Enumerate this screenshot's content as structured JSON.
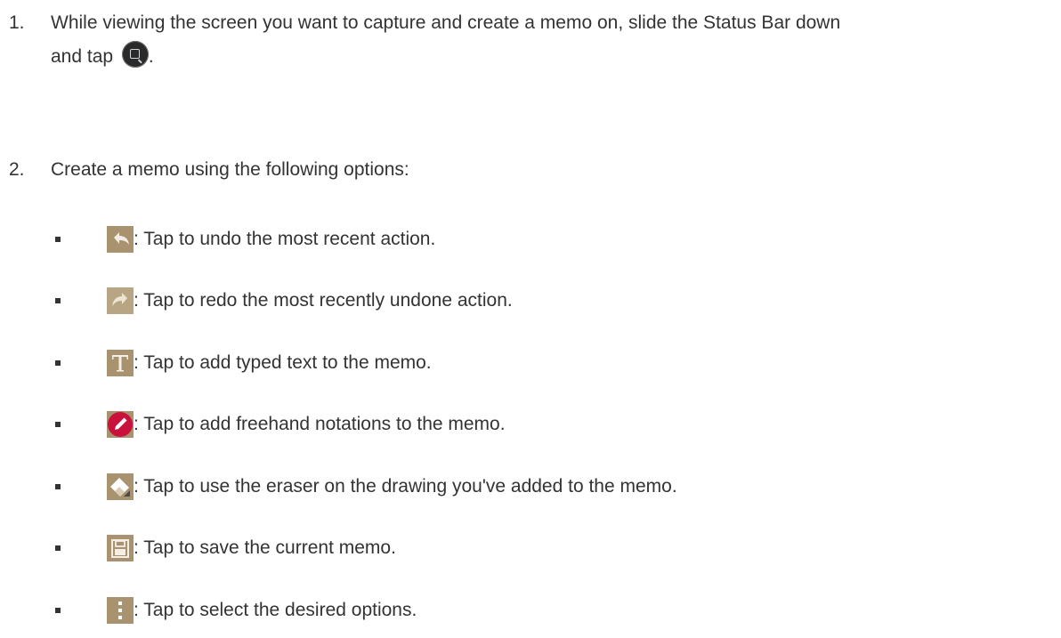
{
  "steps": [
    {
      "number": "1.",
      "text": "While viewing the screen you want to capture and create a memo on, slide the Status Bar down",
      "text2": "and tap",
      "after_icon": "."
    },
    {
      "number": "2.",
      "text": "Create a memo using the following options:"
    }
  ],
  "step1_icon": "capture-memo-icon",
  "options": [
    {
      "icon": "undo-icon",
      "text": ": Tap to undo the most recent action."
    },
    {
      "icon": "redo-icon",
      "text": ": Tap to redo the most recently undone action."
    },
    {
      "icon": "text-icon",
      "text": ": Tap to add typed text to the memo."
    },
    {
      "icon": "pen-icon",
      "text": ": Tap to add freehand notations to the memo."
    },
    {
      "icon": "eraser-icon",
      "text": ": Tap to use the eraser on the drawing you've added to the memo."
    },
    {
      "icon": "save-icon",
      "text": ": Tap to save the current memo."
    },
    {
      "icon": "more-options-icon",
      "text": ": Tap to select the desired options."
    }
  ],
  "colors": {
    "icon_tan": "#a8926f",
    "pen_red": "#c8123c",
    "text": "#333333"
  }
}
